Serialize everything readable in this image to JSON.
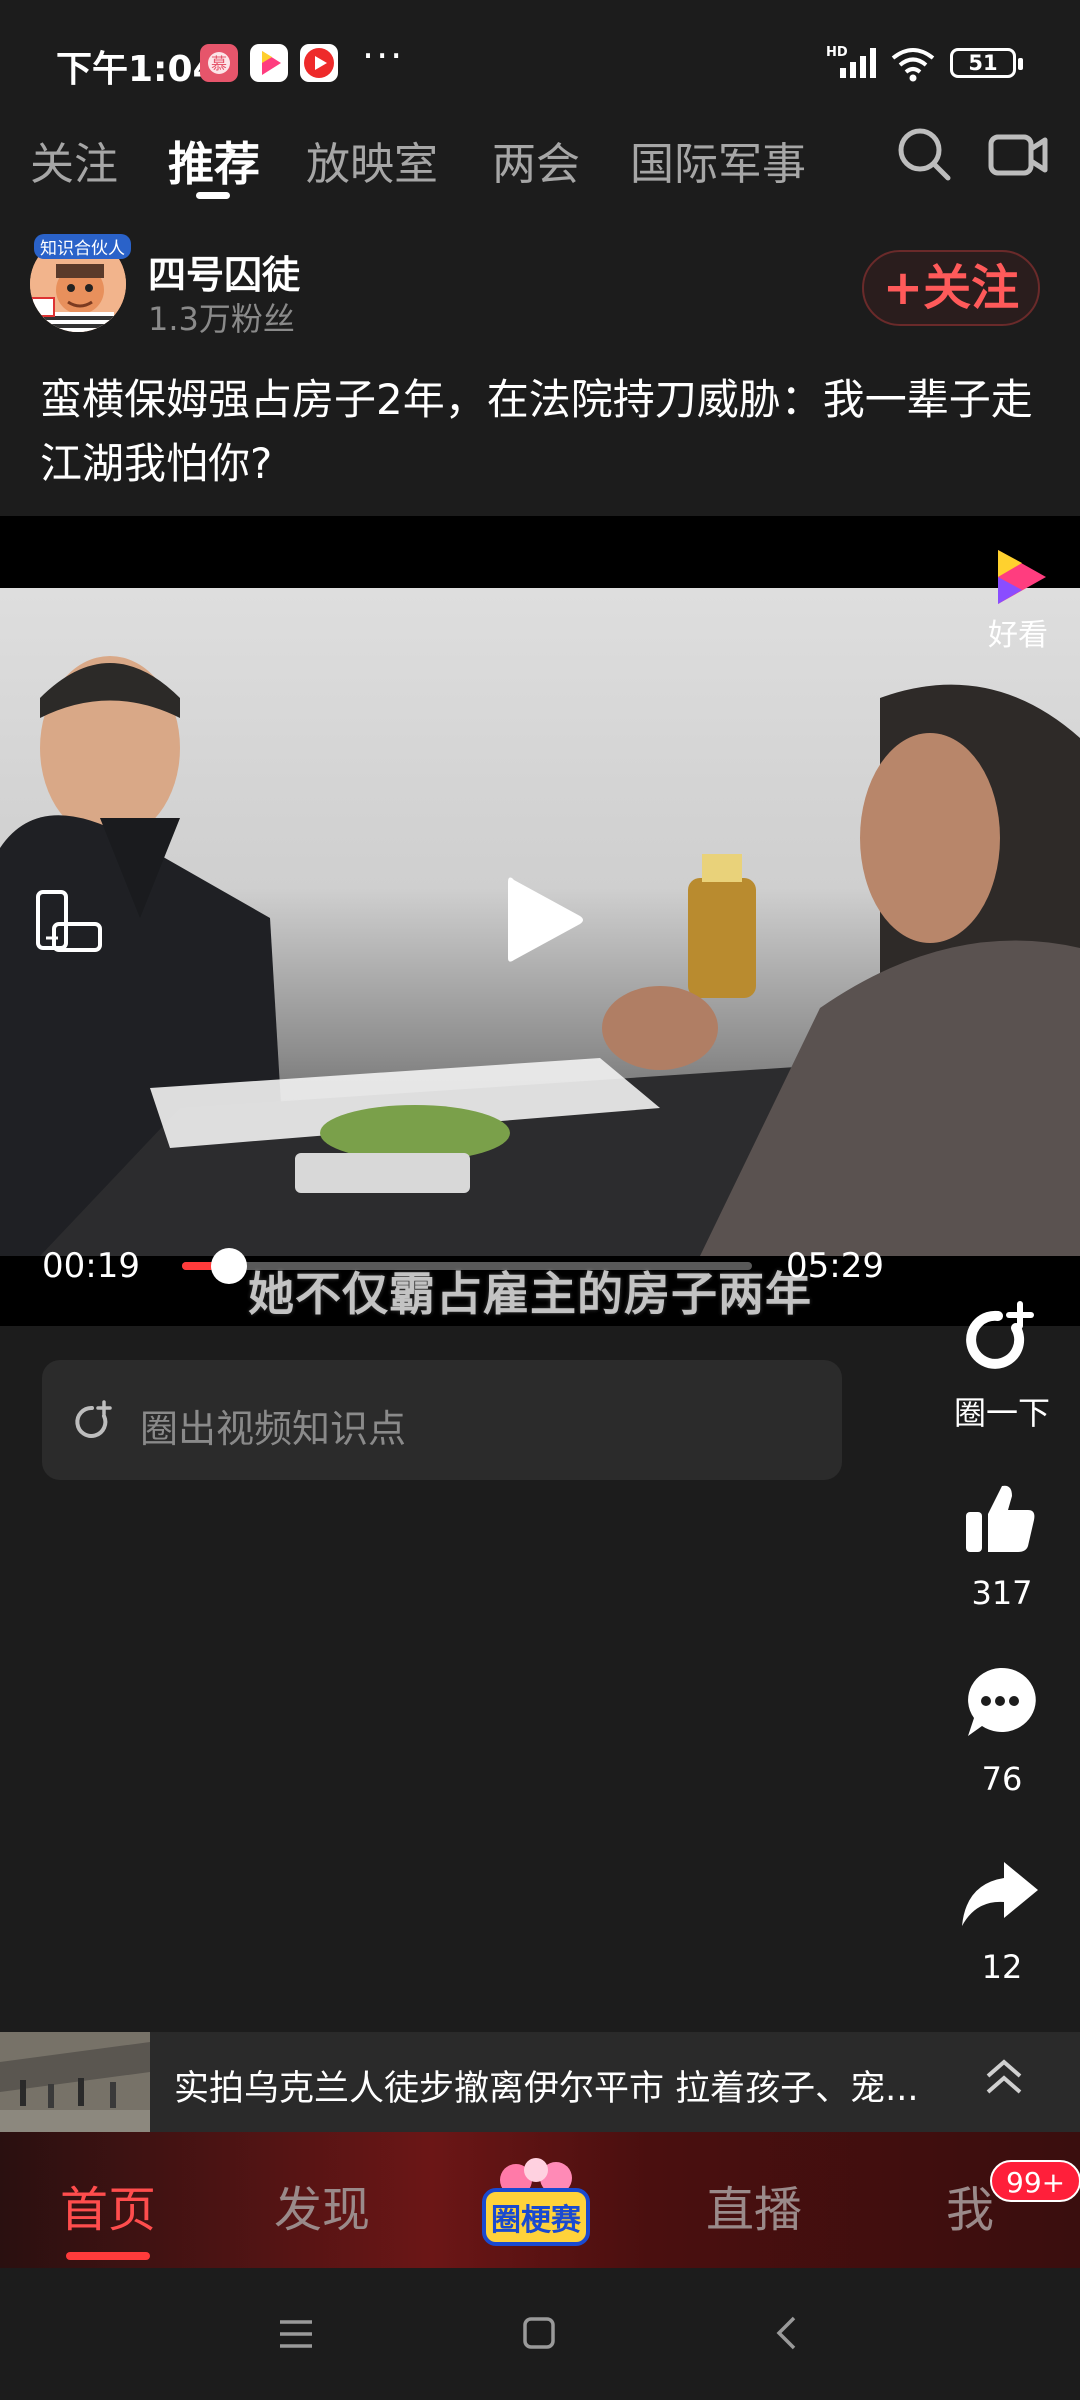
{
  "status_bar": {
    "time": "下午1:04",
    "more": "···",
    "battery": "51",
    "network": "HD"
  },
  "top_tabs": [
    {
      "label": "关注",
      "active": false
    },
    {
      "label": "推荐",
      "active": true
    },
    {
      "label": "放映室",
      "active": false
    },
    {
      "label": "两会",
      "active": false
    },
    {
      "label": "国际军事",
      "active": false
    }
  ],
  "author": {
    "name": "四号囚徒",
    "fans": "1.3万粉丝",
    "follow_label": "+关注",
    "avatar_badge": "知识合伙人"
  },
  "video": {
    "title": "蛮横保姆强占房子2年，在法院持刀威胁：我一辈子走江湖我怕你?",
    "current_time": "00:19",
    "total_time": "05:29",
    "progress": 0.058,
    "subtitle": "她不仅霸占雇主的房子两年",
    "source_label": "好看"
  },
  "knowledge": {
    "placeholder": "圈出视频知识点"
  },
  "actions": {
    "circle_label": "圈一下",
    "likes": "317",
    "comments": "76",
    "shares": "12"
  },
  "ticker": {
    "text": "实拍乌克兰人徒步撤离伊尔平市 拉着孩子、宠..."
  },
  "bottom_nav": {
    "home": "首页",
    "discover": "发现",
    "promo": "圈梗赛",
    "live": "直播",
    "me": "我",
    "badge": "99+"
  },
  "colors": {
    "accent": "#ff3b3b",
    "background": "#1c1c1c"
  }
}
